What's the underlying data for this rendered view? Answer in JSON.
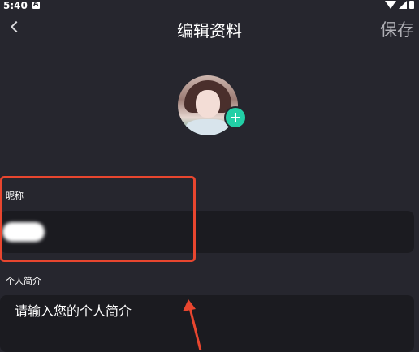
{
  "status_bar": {
    "time": "5:40"
  },
  "nav": {
    "title": "编辑资料",
    "save_label": "保存"
  },
  "profile": {
    "nickname_label": "昵称",
    "nickname_value": "",
    "bio_label": "个人简介",
    "bio_placeholder": "请输入您的个人简介"
  },
  "colors": {
    "background": "#26262e",
    "field_background": "#1b1b20",
    "add_button": "#22cfa6",
    "annotation": "#e8462f"
  },
  "icons": [
    "back-icon",
    "plus-icon",
    "wifi-icon",
    "signal-icon",
    "battery-icon"
  ]
}
